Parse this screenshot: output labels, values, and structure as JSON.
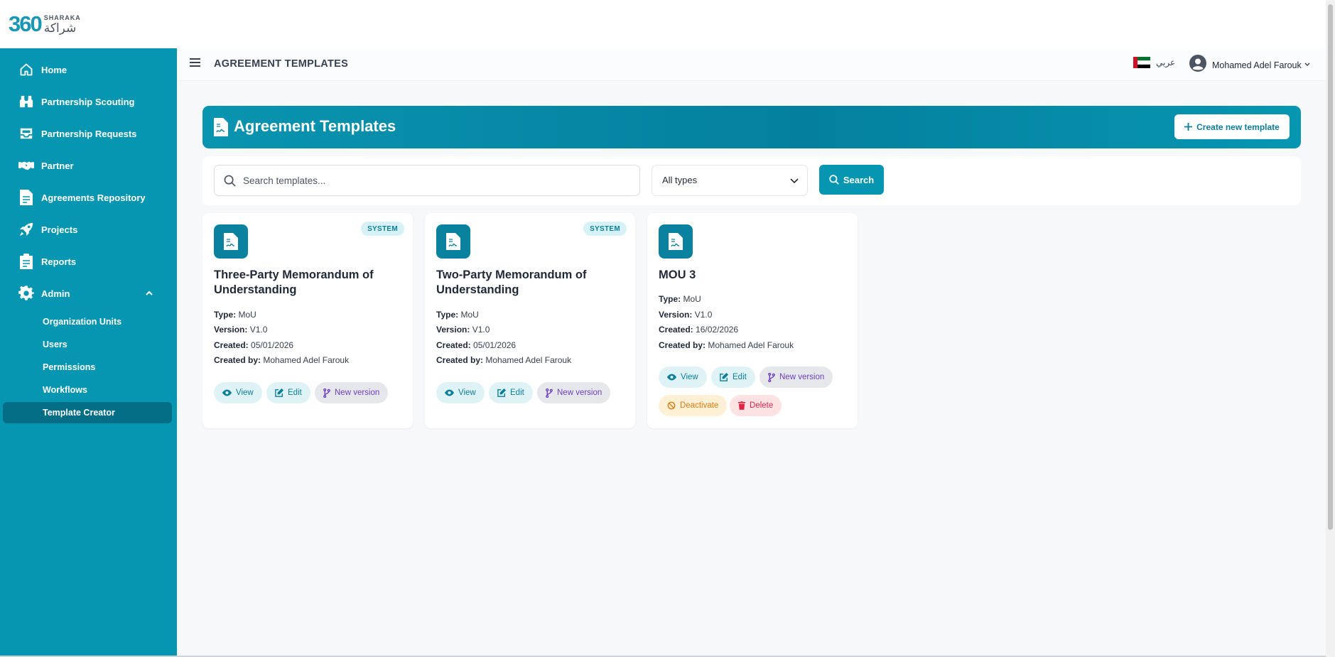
{
  "brand": {
    "number": "360",
    "name_en": "SHARAKA",
    "name_ar": "شراكة"
  },
  "sidebar": {
    "items": [
      {
        "label": "Home",
        "icon": "home-icon"
      },
      {
        "label": "Partnership Scouting",
        "icon": "binoculars-icon"
      },
      {
        "label": "Partnership Requests",
        "icon": "inbox-icon"
      },
      {
        "label": "Partner",
        "icon": "handshake-icon"
      },
      {
        "label": "Agreements Repository",
        "icon": "document-icon"
      },
      {
        "label": "Projects",
        "icon": "rocket-icon"
      },
      {
        "label": "Reports",
        "icon": "clipboard-icon"
      },
      {
        "label": "Admin",
        "icon": "gear-icon"
      }
    ],
    "admin_subitems": [
      {
        "label": "Organization Units"
      },
      {
        "label": "Users"
      },
      {
        "label": "Permissions"
      },
      {
        "label": "Workflows"
      },
      {
        "label": "Template Creator",
        "active": true
      }
    ]
  },
  "header": {
    "title": "AGREEMENT TEMPLATES",
    "language_label": "عربي",
    "user_name": "Mohamed Adel Farouk"
  },
  "banner": {
    "title": "Agreement Templates",
    "create_label": "Create new template"
  },
  "filters": {
    "search_placeholder": "Search templates...",
    "type_value": "All types",
    "search_label": "Search"
  },
  "labels": {
    "type": "Type:",
    "version": "Version:",
    "created": "Created:",
    "created_by": "Created by:",
    "view": "View",
    "edit": "Edit",
    "new_version": "New version",
    "deactivate": "Deactivate",
    "delete": "Delete"
  },
  "cards": [
    {
      "title": "Three-Party Memorandum of Understanding",
      "badge": "SYSTEM",
      "type": "MoU",
      "version": "V1.0",
      "created": "05/01/2026",
      "created_by": "Mohamed Adel Farouk"
    },
    {
      "title": "Two-Party Memorandum of Understanding",
      "badge": "SYSTEM",
      "type": "MoU",
      "version": "V1.0",
      "created": "05/01/2026",
      "created_by": "Mohamed Adel Farouk"
    },
    {
      "title": "MOU 3",
      "type": "MoU",
      "version": "V1.0",
      "created": "16/02/2026",
      "created_by": "Mohamed Adel Farouk"
    }
  ],
  "colors": {
    "sidebar": "#0796b1",
    "active": "#046e87",
    "accent": "#0a7f9b"
  }
}
